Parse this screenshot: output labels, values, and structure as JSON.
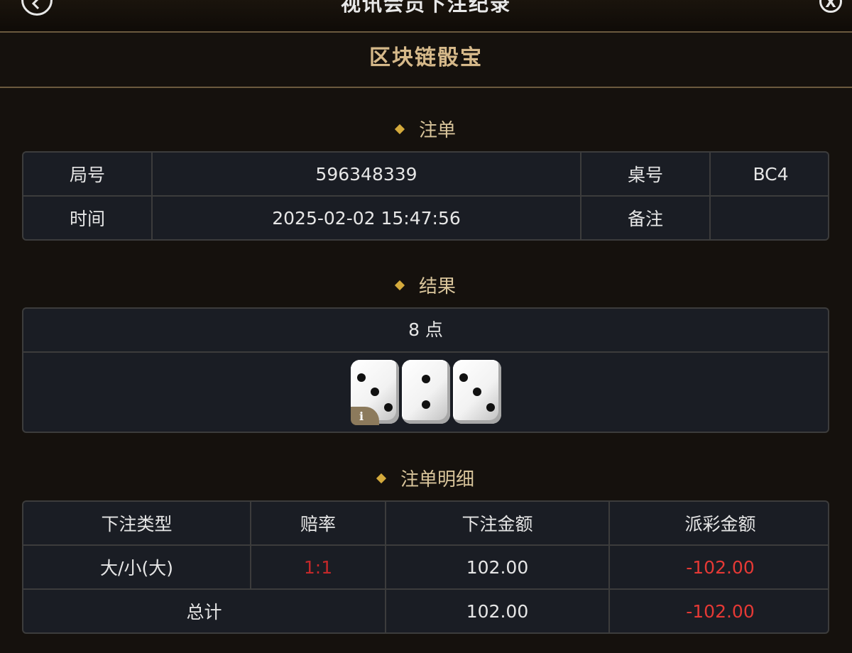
{
  "header": {
    "title": "视讯会员下注纪录",
    "back_icon": "chevron-left-icon",
    "close_label": "X"
  },
  "game": {
    "title": "区块链骰宝"
  },
  "bet_section": {
    "title": "注单",
    "round_label": "局号",
    "round_value": "596348339",
    "table_label": "桌号",
    "table_value": "BC4",
    "time_label": "时间",
    "time_value": "2025-02-02 15:47:56",
    "note_label": "备注",
    "note_value": ""
  },
  "result_section": {
    "title": "结果",
    "total_text": "8 点",
    "dice": [
      3,
      2,
      3
    ],
    "info_label": "i"
  },
  "detail_section": {
    "title": "注单明细",
    "headers": [
      "下注类型",
      "赔率",
      "下注金额",
      "派彩金额"
    ],
    "rows": [
      {
        "type": "大/小(大)",
        "odds": "1:1",
        "amount": "102.00",
        "payout": "-102.00"
      }
    ],
    "total": {
      "label": "总计",
      "amount": "102.00",
      "payout": "-102.00"
    }
  },
  "colors": {
    "background": "#15110d",
    "gold_accent": "#d4aa3c",
    "title_gold": "#d6b98a",
    "negative_red": "#e53935"
  }
}
